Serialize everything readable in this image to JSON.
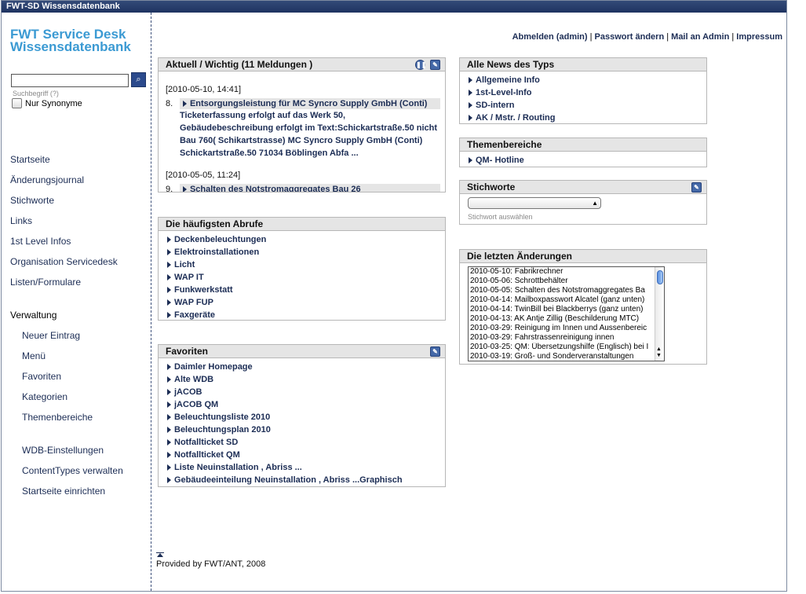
{
  "window": {
    "title": "FWT-SD Wissensdatenbank"
  },
  "logo": {
    "line1": "FWT Service Desk",
    "line2": "Wissensdatenbank"
  },
  "search": {
    "value": "",
    "hint": "Suchbegriff (?)",
    "synonyms_label": "Nur Synonyme"
  },
  "nav": {
    "main": [
      "Startseite",
      "Änderungsjournal",
      "Stichworte",
      "Links",
      "1st Level Infos",
      "Organisation Servicedesk",
      "Listen/Formulare"
    ],
    "admin_title": "Verwaltung",
    "admin_items": [
      "Neuer Eintrag",
      "Menü",
      "Favoriten",
      "Kategorien",
      "Themenbereiche"
    ],
    "settings_items": [
      "WDB-Einstellungen",
      "ContentTypes verwalten",
      "Startseite einrichten"
    ]
  },
  "toplinks": [
    "Abmelden (admin)",
    "Passwort ändern",
    "Mail an Admin",
    "Impressum"
  ],
  "news": {
    "title": "Aktuell / Wichtig (11 Meldungen )",
    "entries": [
      {
        "date": "[2010-05-10, 14:41]",
        "num": "8.",
        "title": "Entsorgungsleistung für MC Syncro Supply GmbH (Conti)",
        "text": "Ticketerfassung erfolgt auf das Werk 50, Gebäudebeschreibung erfolgt im Text:Schickartstraße.50 nicht Bau 760( Schikartstrasse) MC Syncro Supply GmbH (Conti) Schickartstraße.50 71034 Böblingen Abfa ..."
      },
      {
        "date": "[2010-05-05, 11:24]",
        "num": "9.",
        "title": "Schalten des Notstromaggregates Bau 26",
        "text": ""
      }
    ]
  },
  "popular": {
    "title": "Die häufigsten Abrufe",
    "items": [
      "Deckenbeleuchtungen",
      "Elektroinstallationen",
      "Licht",
      "WAP IT",
      "Funkwerkstatt",
      "WAP FUP",
      "Faxgeräte"
    ]
  },
  "favorites": {
    "title": "Favoriten",
    "items": [
      "Daimler Homepage",
      "Alte WDB",
      "jACOB",
      "jACOB QM",
      "Beleuchtungsliste 2010",
      "Beleuchtungsplan 2010",
      "Notfallticket SD",
      "Notfallticket QM",
      "Liste Neuinstallation , Abriss ...",
      "Gebäudeeinteilung Neuinstallation , Abriss ...Graphisch"
    ]
  },
  "news_types": {
    "title": "Alle News des Typs",
    "items": [
      "Allgemeine Info",
      "1st-Level-Info",
      "SD-intern",
      "AK / Mstr. / Routing"
    ]
  },
  "topics": {
    "title": "Themenbereiche",
    "items": [
      "QM- Hotline"
    ]
  },
  "keywords": {
    "title": "Stichworte",
    "selected": "",
    "hint": "Stichwort auswählen"
  },
  "changes": {
    "title": "Die letzten Änderungen",
    "items": [
      "2010-05-10: Fabrikrechner",
      "2010-05-06: Schrottbehälter",
      "2010-05-05: Schalten des Notstromaggregates Ba",
      "2010-04-14: Mailboxpasswort Alcatel (ganz unten)",
      "2010-04-14: TwinBill bei Blackberrys (ganz unten)",
      "2010-04-13: AK Antje Zillig (Beschilderung MTC)",
      "2010-03-29: Reinigung im Innen und Aussenbereic",
      "2010-03-29: Fahrstrassenreinigung innen",
      "2010-03-25: QM: Übersetzungshilfe (Englisch) bei I",
      "2010-03-19: Groß- und Sonderveranstaltungen"
    ]
  },
  "footer": "Provided by FWT/ANT, 2008",
  "colors": {
    "accent": "#3b9ad3",
    "link": "#1c2d55",
    "topbar": "#2a4170",
    "box_header": "#e5e5e5"
  }
}
